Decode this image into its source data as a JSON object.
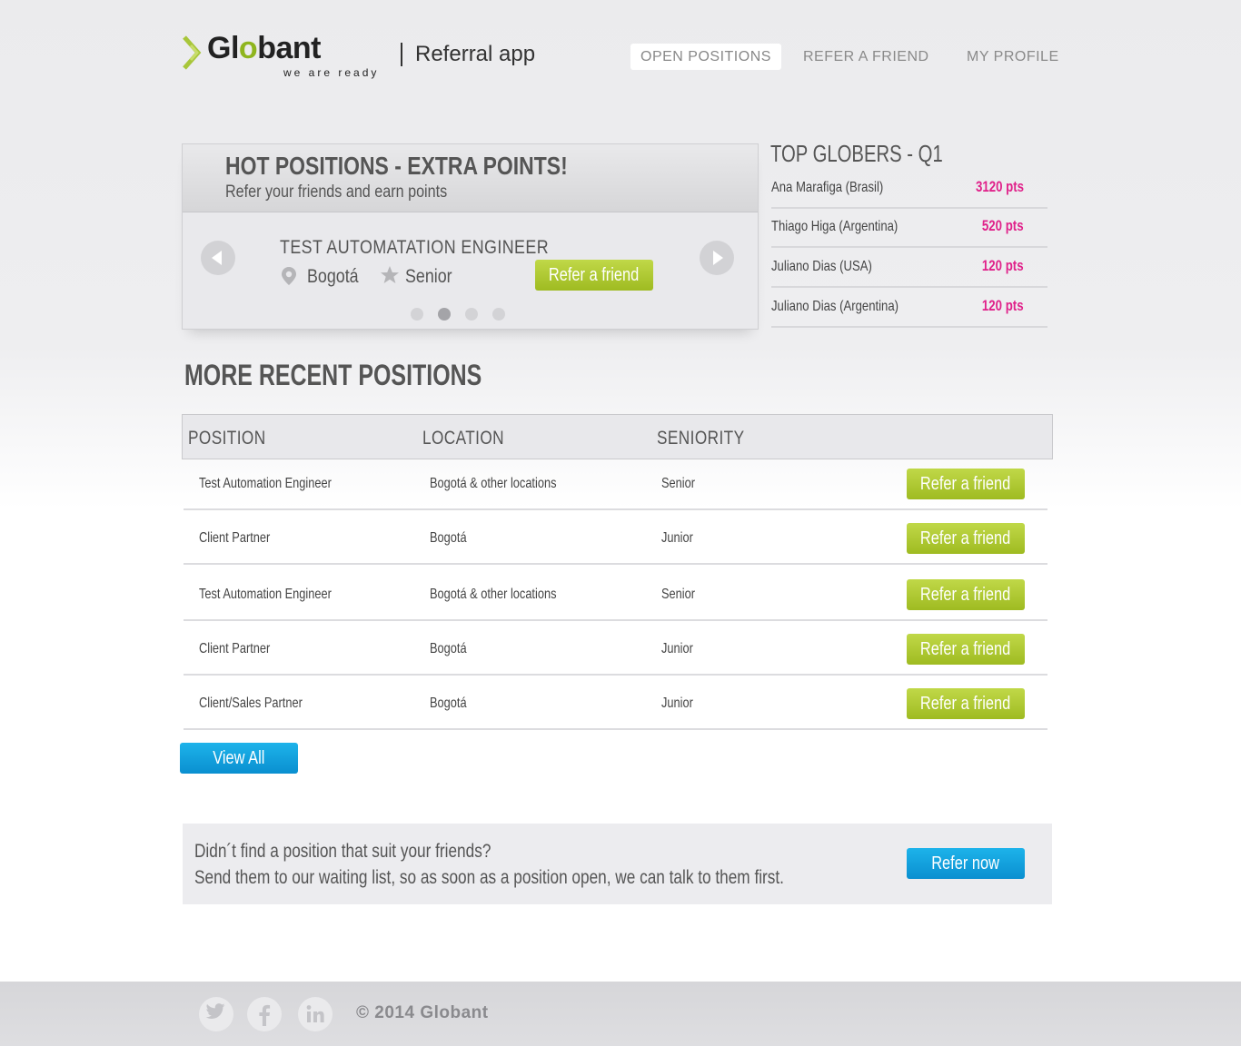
{
  "header": {
    "logo_text_a": "Gl",
    "logo_text_b": "o",
    "logo_text_c": "bant",
    "logo_tagline": "we are ready",
    "app_title": "Referral app",
    "nav": {
      "open_positions": "OPEN POSITIONS",
      "refer_a_friend": "REFER A FRIEND",
      "my_profile": "MY PROFILE"
    }
  },
  "hot": {
    "title": "HOT POSITIONS - EXTRA POINTS!",
    "subtitle": "Refer your friends and earn points",
    "job_title": "TEST AUTOMATATION ENGINEER",
    "location": "Bogotá",
    "seniority": "Senior",
    "refer_label": "Refer a friend",
    "active_slide": 2,
    "slide_count": 4
  },
  "top_globers": {
    "title": "TOP GLOBERS - Q1",
    "rows": [
      {
        "name": "Ana Marafiga (Brasil)",
        "points": "3120 pts"
      },
      {
        "name": "Thiago Higa (Argentina)",
        "points": "520 pts"
      },
      {
        "name": "Juliano Dias (USA)",
        "points": "120 pts"
      },
      {
        "name": "Juliano Dias (Argentina)",
        "points": "120 pts"
      }
    ]
  },
  "recent": {
    "title": "MORE RECENT POSITIONS",
    "columns": {
      "position": "POSITION",
      "location": "LOCATION",
      "seniority": "SENIORITY"
    },
    "rows": [
      {
        "position": "Test Automation Engineer",
        "location": "Bogotá & other locations",
        "seniority": "Senior",
        "action": "Refer a friend"
      },
      {
        "position": "Client Partner",
        "location": "Bogotá",
        "seniority": "Junior",
        "action": "Refer a friend"
      },
      {
        "position": "Test Automation Engineer",
        "location": "Bogotá & other locations",
        "seniority": "Senior",
        "action": "Refer a friend"
      },
      {
        "position": "Client Partner",
        "location": "Bogotá",
        "seniority": "Junior",
        "action": "Refer a friend"
      },
      {
        "position": "Client/Sales Partner",
        "location": "Bogotá",
        "seniority": "Junior",
        "action": "Refer a friend"
      }
    ],
    "view_all": "View All"
  },
  "waiting": {
    "line1": "Didn´t find a position that suit your friends?",
    "line2": "Send them to our waiting list, so as soon as a position open, we can talk to them first.",
    "button": "Refer now"
  },
  "footer": {
    "copyright": "© 2014 Globant",
    "social_icons": [
      "twitter-icon",
      "facebook-icon",
      "linkedin-icon"
    ]
  },
  "colors": {
    "accent_green": "#a6c22a",
    "accent_blue": "#0ea2e0",
    "points_pink": "#e0218a"
  }
}
